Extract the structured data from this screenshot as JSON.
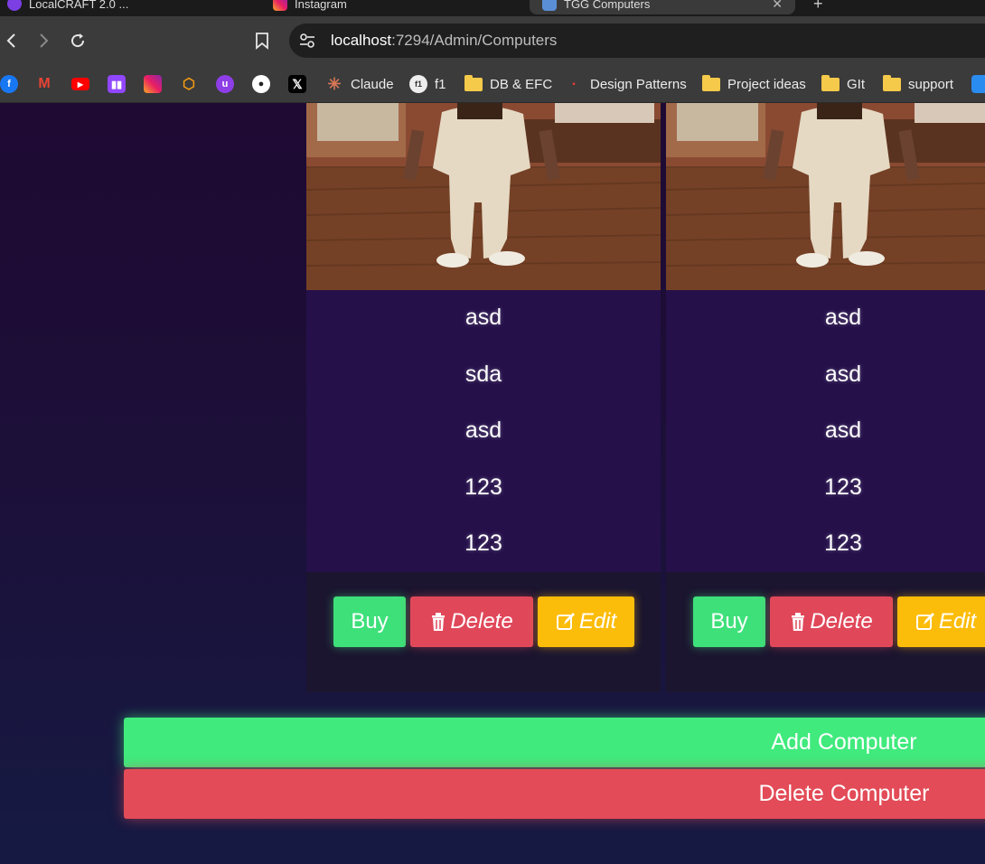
{
  "browser": {
    "tabs": [
      {
        "label": "LocalCRAFT 2.0 ..."
      },
      {
        "label": "Instagram"
      },
      {
        "label": "TGG Computers"
      }
    ],
    "url_host": "localhost",
    "url_rest": ":7294/Admin/Computers",
    "bookmarks": [
      {
        "icon": "facebook-icon",
        "label": ""
      },
      {
        "icon": "gmail-icon",
        "label": ""
      },
      {
        "icon": "youtube-icon",
        "label": ""
      },
      {
        "icon": "twitch-icon",
        "label": ""
      },
      {
        "icon": "instagram-icon",
        "label": ""
      },
      {
        "icon": "box-icon",
        "label": ""
      },
      {
        "icon": "u-icon",
        "label": ""
      },
      {
        "icon": "github-icon",
        "label": ""
      },
      {
        "icon": "x-icon",
        "label": ""
      },
      {
        "icon": "claude-icon",
        "label": "Claude"
      },
      {
        "icon": "f1-icon",
        "label": "f1"
      },
      {
        "icon": "folder-icon",
        "label": "DB & EFC"
      },
      {
        "icon": "design-patterns-icon",
        "label": "Design Patterns"
      },
      {
        "icon": "folder-icon",
        "label": "Project ideas"
      },
      {
        "icon": "folder-icon",
        "label": "GIt"
      },
      {
        "icon": "folder-icon",
        "label": "support"
      }
    ]
  },
  "cards": [
    {
      "lines": [
        "asd",
        "sda",
        "asd",
        "123",
        "123"
      ],
      "buy_label": "Buy",
      "delete_label": "Delete",
      "edit_label": "Edit"
    },
    {
      "lines": [
        "asd",
        "asd",
        "asd",
        "123",
        "123"
      ],
      "buy_label": "Buy",
      "delete_label": "Delete",
      "edit_label": "Edit"
    }
  ],
  "actions": {
    "add_label": "Add Computer",
    "delete_label": "Delete Computer"
  },
  "colors": {
    "buy": "#3ee07a",
    "delete": "#e0485a",
    "edit": "#fcbc0a",
    "card_body": "#25104a"
  }
}
